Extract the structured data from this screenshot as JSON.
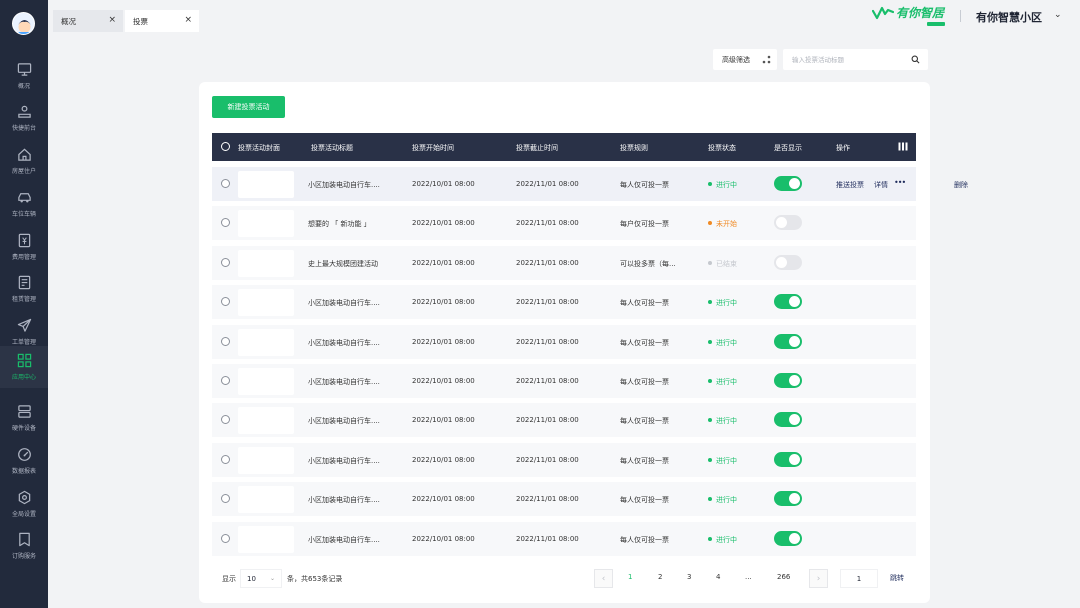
{
  "sidebar": {
    "items": [
      {
        "label": "概况",
        "icon": "monitor-icon"
      },
      {
        "label": "快捷前台",
        "icon": "reception-icon"
      },
      {
        "label": "房屋住户",
        "icon": "home-icon"
      },
      {
        "label": "车位车辆",
        "icon": "car-icon"
      },
      {
        "label": "费用管理",
        "icon": "fee-icon"
      },
      {
        "label": "租赁管理",
        "icon": "lease-icon"
      },
      {
        "label": "工单管理",
        "icon": "send-icon"
      },
      {
        "label": "应用中心",
        "icon": "apps-icon"
      },
      {
        "label": "硬件设备",
        "icon": "server-icon"
      },
      {
        "label": "数据报表",
        "icon": "dashboard-icon"
      },
      {
        "label": "全局设置",
        "icon": "settings-icon"
      },
      {
        "label": "订购服务",
        "icon": "bookmark-icon"
      }
    ],
    "active_index": 7
  },
  "tabs": [
    {
      "label": "概况",
      "close": "×"
    },
    {
      "label": "投票",
      "close": "×"
    }
  ],
  "header": {
    "brand": "有你智居",
    "community": "有你智慧小区",
    "caret": "⌄"
  },
  "filter": {
    "advanced_label": "高级筛选",
    "search_placeholder": "输入投票活动标题"
  },
  "actions": {
    "new_label": "新建投票活动"
  },
  "table": {
    "headers": {
      "cover": "投票活动封面",
      "title": "投票活动标题",
      "start": "投票开始时间",
      "end": "投票截止时间",
      "rule": "投票规则",
      "status": "投票状态",
      "display": "是否显示",
      "ops": "操作"
    },
    "row_ops": {
      "push": "推送投票",
      "detail": "详情",
      "more": "•••",
      "delete": "删除"
    },
    "rows": [
      {
        "title": "小区加装电动自行车....",
        "start": "2022/10/01 08:00",
        "end": "2022/11/01 08:00",
        "rule": "每人仅可投一票",
        "status": "进行中",
        "status_color": "#19be6b",
        "display": true
      },
      {
        "title": "想要的 「 新功能 」",
        "start": "2022/10/01 08:00",
        "end": "2022/11/01 08:00",
        "rule": "每户仅可投一票",
        "status": "未开始",
        "status_color": "#f08a24",
        "display": false
      },
      {
        "title": "史上最大规模团建活动",
        "start": "2022/10/01 08:00",
        "end": "2022/11/01 08:00",
        "rule": "可以投多票（每...",
        "status": "已结束",
        "status_color": "#c5c8ce",
        "display": false
      },
      {
        "title": "小区加装电动自行车....",
        "start": "2022/10/01 08:00",
        "end": "2022/11/01 08:00",
        "rule": "每人仅可投一票",
        "status": "进行中",
        "status_color": "#19be6b",
        "display": true
      },
      {
        "title": "小区加装电动自行车....",
        "start": "2022/10/01 08:00",
        "end": "2022/11/01 08:00",
        "rule": "每人仅可投一票",
        "status": "进行中",
        "status_color": "#19be6b",
        "display": true
      },
      {
        "title": "小区加装电动自行车....",
        "start": "2022/10/01 08:00",
        "end": "2022/11/01 08:00",
        "rule": "每人仅可投一票",
        "status": "进行中",
        "status_color": "#19be6b",
        "display": true
      },
      {
        "title": "小区加装电动自行车....",
        "start": "2022/10/01 08:00",
        "end": "2022/11/01 08:00",
        "rule": "每人仅可投一票",
        "status": "进行中",
        "status_color": "#19be6b",
        "display": true
      },
      {
        "title": "小区加装电动自行车....",
        "start": "2022/10/01 08:00",
        "end": "2022/11/01 08:00",
        "rule": "每人仅可投一票",
        "status": "进行中",
        "status_color": "#19be6b",
        "display": true
      },
      {
        "title": "小区加装电动自行车....",
        "start": "2022/10/01 08:00",
        "end": "2022/11/01 08:00",
        "rule": "每人仅可投一票",
        "status": "进行中",
        "status_color": "#19be6b",
        "display": true
      },
      {
        "title": "小区加装电动自行车....",
        "start": "2022/10/01 08:00",
        "end": "2022/11/01 08:00",
        "rule": "每人仅可投一票",
        "status": "进行中",
        "status_color": "#19be6b",
        "display": true
      }
    ]
  },
  "pagination": {
    "show_label": "显示",
    "page_size": "10",
    "total_text": "条，共653条记录",
    "prev": "‹",
    "next": "›",
    "pages": [
      "1",
      "2",
      "3",
      "4",
      "...",
      "266"
    ],
    "current_page": "1",
    "jump_value": "1",
    "jump_label": "跳转"
  },
  "colors": {
    "accent": "#19be6b",
    "sidebar_bg": "#222a3c",
    "table_header_bg": "#293147"
  }
}
